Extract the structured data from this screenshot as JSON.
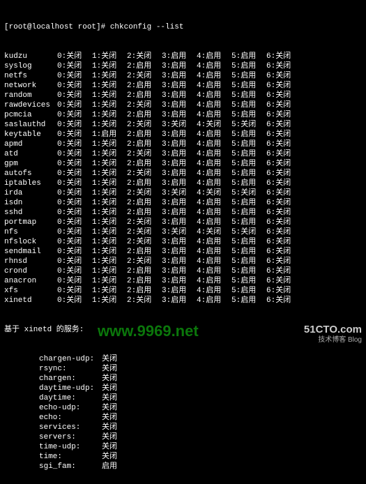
{
  "prompt": "[root@localhost root]# chkconfig --list",
  "levels": [
    "0",
    "1",
    "2",
    "3",
    "4",
    "5",
    "6"
  ],
  "on": "启用",
  "off": "关闭",
  "services": [
    {
      "name": "kudzu",
      "v": [
        "关闭",
        "关闭",
        "关闭",
        "启用",
        "启用",
        "启用",
        "关闭"
      ]
    },
    {
      "name": "syslog",
      "v": [
        "关闭",
        "关闭",
        "启用",
        "启用",
        "启用",
        "启用",
        "关闭"
      ]
    },
    {
      "name": "netfs",
      "v": [
        "关闭",
        "关闭",
        "关闭",
        "启用",
        "启用",
        "启用",
        "关闭"
      ]
    },
    {
      "name": "network",
      "v": [
        "关闭",
        "关闭",
        "启用",
        "启用",
        "启用",
        "启用",
        "关闭"
      ]
    },
    {
      "name": "random",
      "v": [
        "关闭",
        "关闭",
        "启用",
        "启用",
        "启用",
        "启用",
        "关闭"
      ]
    },
    {
      "name": "rawdevices",
      "v": [
        "关闭",
        "关闭",
        "关闭",
        "启用",
        "启用",
        "启用",
        "关闭"
      ]
    },
    {
      "name": "pcmcia",
      "v": [
        "关闭",
        "关闭",
        "启用",
        "启用",
        "启用",
        "启用",
        "关闭"
      ]
    },
    {
      "name": "saslauthd",
      "v": [
        "关闭",
        "关闭",
        "关闭",
        "关闭",
        "关闭",
        "关闭",
        "关闭"
      ]
    },
    {
      "name": "keytable",
      "v": [
        "关闭",
        "启用",
        "启用",
        "启用",
        "启用",
        "启用",
        "关闭"
      ]
    },
    {
      "name": "apmd",
      "v": [
        "关闭",
        "关闭",
        "启用",
        "启用",
        "启用",
        "启用",
        "关闭"
      ]
    },
    {
      "name": "atd",
      "v": [
        "关闭",
        "关闭",
        "关闭",
        "启用",
        "启用",
        "启用",
        "关闭"
      ]
    },
    {
      "name": "gpm",
      "v": [
        "关闭",
        "关闭",
        "启用",
        "启用",
        "启用",
        "启用",
        "关闭"
      ]
    },
    {
      "name": "autofs",
      "v": [
        "关闭",
        "关闭",
        "关闭",
        "启用",
        "启用",
        "启用",
        "关闭"
      ]
    },
    {
      "name": "iptables",
      "v": [
        "关闭",
        "关闭",
        "启用",
        "启用",
        "启用",
        "启用",
        "关闭"
      ]
    },
    {
      "name": "irda",
      "v": [
        "关闭",
        "关闭",
        "关闭",
        "关闭",
        "关闭",
        "关闭",
        "关闭"
      ]
    },
    {
      "name": "isdn",
      "v": [
        "关闭",
        "关闭",
        "启用",
        "启用",
        "启用",
        "启用",
        "关闭"
      ]
    },
    {
      "name": "sshd",
      "v": [
        "关闭",
        "关闭",
        "启用",
        "启用",
        "启用",
        "启用",
        "关闭"
      ]
    },
    {
      "name": "portmap",
      "v": [
        "关闭",
        "关闭",
        "关闭",
        "启用",
        "启用",
        "启用",
        "关闭"
      ]
    },
    {
      "name": "nfs",
      "v": [
        "关闭",
        "关闭",
        "关闭",
        "关闭",
        "关闭",
        "关闭",
        "关闭"
      ]
    },
    {
      "name": "nfslock",
      "v": [
        "关闭",
        "关闭",
        "关闭",
        "启用",
        "启用",
        "启用",
        "关闭"
      ]
    },
    {
      "name": "sendmail",
      "v": [
        "关闭",
        "关闭",
        "启用",
        "启用",
        "启用",
        "启用",
        "关闭"
      ]
    },
    {
      "name": "rhnsd",
      "v": [
        "关闭",
        "关闭",
        "关闭",
        "启用",
        "启用",
        "启用",
        "关闭"
      ]
    },
    {
      "name": "crond",
      "v": [
        "关闭",
        "关闭",
        "启用",
        "启用",
        "启用",
        "启用",
        "关闭"
      ]
    },
    {
      "name": "anacron",
      "v": [
        "关闭",
        "关闭",
        "启用",
        "启用",
        "启用",
        "启用",
        "关闭"
      ]
    },
    {
      "name": "xfs",
      "v": [
        "关闭",
        "关闭",
        "启用",
        "启用",
        "启用",
        "启用",
        "关闭"
      ]
    },
    {
      "name": "xinetd",
      "v": [
        "关闭",
        "关闭",
        "关闭",
        "启用",
        "启用",
        "启用",
        "关闭"
      ]
    }
  ],
  "xinetd_header": "基于 xinetd 的服务:",
  "xinetd_services": [
    {
      "name": "chargen-udp:",
      "status": "关闭"
    },
    {
      "name": "rsync:",
      "status": "关闭"
    },
    {
      "name": "chargen:",
      "status": "关闭"
    },
    {
      "name": "daytime-udp:",
      "status": "关闭"
    },
    {
      "name": "daytime:",
      "status": "关闭"
    },
    {
      "name": "echo-udp:",
      "status": "关闭"
    },
    {
      "name": "echo:",
      "status": "关闭"
    },
    {
      "name": "services:",
      "status": "关闭"
    },
    {
      "name": "servers:",
      "status": "关闭"
    },
    {
      "name": "time-udp:",
      "status": "关闭"
    },
    {
      "name": "time:",
      "status": "关闭"
    },
    {
      "name": "sgi_fam:",
      "status": "启用"
    }
  ],
  "watermark1": "www.9969.net",
  "watermark2_main": "51CTO.com",
  "watermark2_sub": "技术博客 Blog"
}
